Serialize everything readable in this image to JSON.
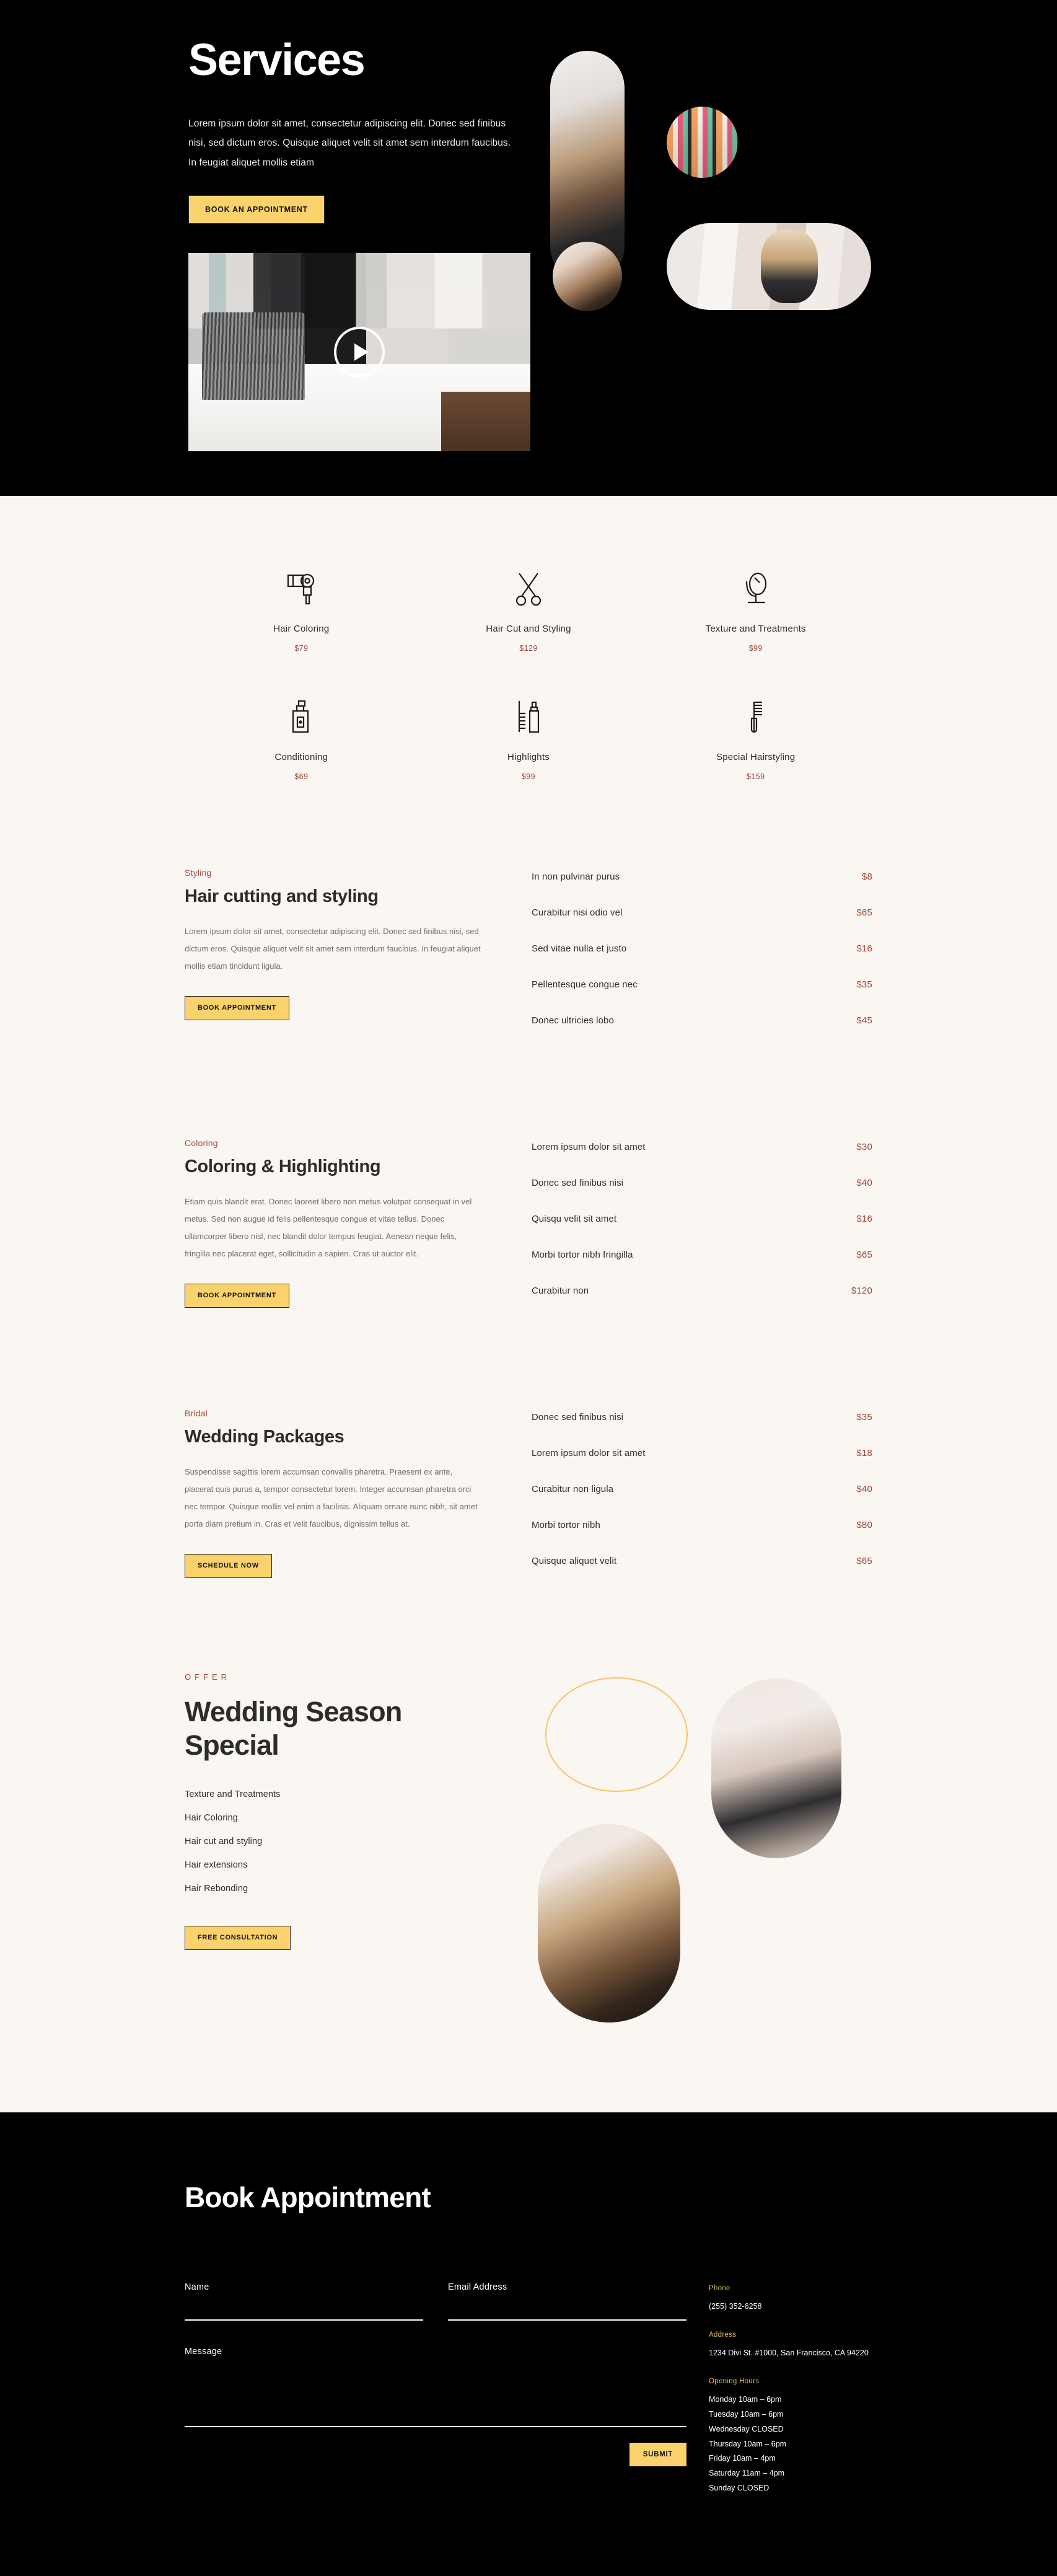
{
  "hero": {
    "title": "Services",
    "description": "Lorem ipsum dolor sit amet, consectetur adipiscing elit. Donec sed finibus nisi, sed dictum eros. Quisque aliquet velit sit amet sem interdum faucibus. In feugiat aliquet mollis etiam",
    "cta_label": "BOOK AN APPOINTMENT"
  },
  "service_grid": [
    {
      "icon": "hair-dryer-icon",
      "name": "Hair Coloring",
      "price": "$79"
    },
    {
      "icon": "scissors-icon",
      "name": "Hair Cut and Styling",
      "price": "$129"
    },
    {
      "icon": "mirror-icon",
      "name": "Texture and Treatments",
      "price": "$99"
    },
    {
      "icon": "spray-bottle-icon",
      "name": "Conditioning",
      "price": "$69"
    },
    {
      "icon": "comb-and-bottle-icon",
      "name": "Highlights",
      "price": "$99"
    },
    {
      "icon": "comb-icon",
      "name": "Special Hairstyling",
      "price": "$159"
    }
  ],
  "price_sections": [
    {
      "eyebrow": "Styling",
      "title": "Hair cutting and styling",
      "body": "Lorem ipsum dolor sit amet, consectetur adipiscing elit. Donec sed finibus nisi, sed dictum eros. Quisque aliquet velit sit amet sem interdum faucibus. In feugiat aliquet mollis etiam tincidunt ligula.",
      "button": "BOOK APPOINTMENT",
      "items": [
        {
          "name": "In non pulvinar purus",
          "price": "$8"
        },
        {
          "name": "Curabitur nisi odio vel",
          "price": "$65"
        },
        {
          "name": "Sed vitae nulla et justo",
          "price": "$16"
        },
        {
          "name": "Pellentesque congue nec",
          "price": "$35"
        },
        {
          "name": "Donec ultricies lobo",
          "price": "$45"
        }
      ]
    },
    {
      "eyebrow": "Coloring",
      "title": "Coloring & Highlighting",
      "body": "Etiam quis blandit erat. Donec laoreet libero non metus volutpat consequat in vel metus. Sed non augue id felis pellentesque congue et vitae tellus. Donec ullamcorper libero nisl, nec blandit dolor tempus feugiat. Aenean neque felis, fringilla nec placerat eget, sollicitudin a sapien. Cras ut auctor elit.",
      "button": "BOOK APPOINTMENT",
      "items": [
        {
          "name": "Lorem ipsum dolor sit amet",
          "price": "$30"
        },
        {
          "name": "Donec sed finibus nisi",
          "price": "$40"
        },
        {
          "name": "Quisqu velit sit amet",
          "price": "$16"
        },
        {
          "name": "Morbi tortor nibh fringilla",
          "price": "$65"
        },
        {
          "name": "Curabitur non",
          "price": "$120"
        }
      ]
    },
    {
      "eyebrow": "Bridal",
      "title": "Wedding Packages",
      "body": "Suspendisse sagittis lorem accumsan convallis pharetra. Praesent ex ante, placerat quis purus a, tempor consectetur lorem. Integer accumsan pharetra orci nec tempor. Quisque mollis vel enim a facilisis. Aliquam ornare nunc nibh, sit amet porta diam pretium in. Cras et velit faucibus, dignissim tellus at.",
      "button": "SCHEDULE NOW",
      "items": [
        {
          "name": "Donec sed finibus nisi",
          "price": "$35"
        },
        {
          "name": "Lorem ipsum dolor sit amet",
          "price": "$18"
        },
        {
          "name": "Curabitur non ligula",
          "price": "$40"
        },
        {
          "name": "Morbi tortor nibh",
          "price": "$80"
        },
        {
          "name": "Quisque aliquet velit",
          "price": "$65"
        }
      ]
    }
  ],
  "offer": {
    "eyebrow": "OFFER",
    "title": "Wedding Season Special",
    "items": [
      "Texture and Treatments",
      "Hair Coloring",
      "Hair cut and styling",
      "Hair extensions",
      "Hair Rebonding"
    ],
    "button": "FREE CONSULTATION"
  },
  "footer": {
    "title": "Book Appointment",
    "form": {
      "name_label": "Name",
      "name_value": "",
      "email_label": "Email Address",
      "email_value": "",
      "message_label": "Message",
      "message_value": "",
      "submit_label": "SUBMIT"
    },
    "phone_label": "Phone",
    "phone_value": "(255) 352-6258",
    "address_label": "Address",
    "address_value": "1234 Divi St. #1000, San Francisco, CA 94220",
    "hours_label": "Opening Hours",
    "hours": [
      "Monday 10am – 6pm",
      "Tuesday 10am – 6pm",
      "Wednesday CLOSED",
      "Thursday 10am – 6pm",
      "Friday 10am – 4pm",
      "Saturday 11am – 4pm",
      "Sunday CLOSED"
    ]
  },
  "colors": {
    "accent_yellow": "#fbd26c",
    "accent_rust": "#9b4a3a",
    "cream": "#faf6f2",
    "black": "#000000",
    "gold_label": "#e2b857"
  }
}
